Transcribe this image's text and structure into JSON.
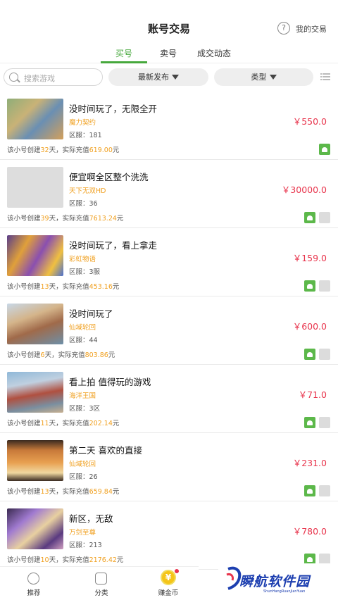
{
  "header": {
    "title": "账号交易",
    "help_symbol": "?",
    "my_trades": "我的交易"
  },
  "tabs": [
    {
      "label": "买号",
      "active": true
    },
    {
      "label": "卖号",
      "active": false
    },
    {
      "label": "成交动态",
      "active": false
    }
  ],
  "filters": {
    "search_placeholder": "搜索游戏",
    "sort": "最新发布",
    "type": "类型"
  },
  "listings": [
    {
      "title": "没时间玩了，无限全开",
      "game": "魔力契约",
      "server": "区服：181",
      "price": "￥550.0",
      "days": "32",
      "recharge": "619.00",
      "has_gray": false,
      "thumb": "a"
    },
    {
      "title": "便宜啊全区整个洗洗",
      "game": "天下无双HD",
      "server": "区服：36",
      "price": "￥30000.0",
      "days": "39",
      "recharge": "7613.24",
      "has_gray": true,
      "thumb": "blank"
    },
    {
      "title": "没时间玩了，看上拿走",
      "game": "彩虹物语",
      "server": "区服：3服",
      "price": "￥159.0",
      "days": "13",
      "recharge": "453.16",
      "has_gray": true,
      "thumb": "b"
    },
    {
      "title": "没时间玩了",
      "game": "仙域轮回",
      "server": "区服：44",
      "price": "￥600.0",
      "days": "6",
      "recharge": "803.86",
      "has_gray": true,
      "thumb": "c"
    },
    {
      "title": "看上拍 值得玩的游戏",
      "game": "海洋王国",
      "server": "区服：3区",
      "price": "￥71.0",
      "days": "11",
      "recharge": "202.14",
      "has_gray": true,
      "thumb": "d"
    },
    {
      "title": "第二天  喜欢的直接",
      "game": "仙域轮回",
      "server": "区服：26",
      "price": "￥231.0",
      "days": "13",
      "recharge": "659.84",
      "has_gray": true,
      "thumb": "e"
    },
    {
      "title": "新区，无敌",
      "game": "万剑至尊",
      "server": "区服：213",
      "price": "￥780.0",
      "days": "10",
      "recharge": "2176.42",
      "has_gray": true,
      "thumb": "f"
    }
  ],
  "meta_text": {
    "prefix": "该小号创建",
    "mid": "天，实际充值",
    "suffix": "元"
  },
  "tabbar": [
    {
      "label": "推荐",
      "icon": "recommend-icon"
    },
    {
      "label": "分类",
      "icon": "category-icon"
    },
    {
      "label": "赚金币",
      "icon": "coin-icon",
      "coin_symbol": "¥"
    }
  ],
  "watermark": {
    "text": "瞬航软件园",
    "sub": "ShunHangRuanJianYuan"
  },
  "colors": {
    "accent": "#46a83c",
    "price": "#e8344c",
    "highlight": "#f0a020"
  }
}
